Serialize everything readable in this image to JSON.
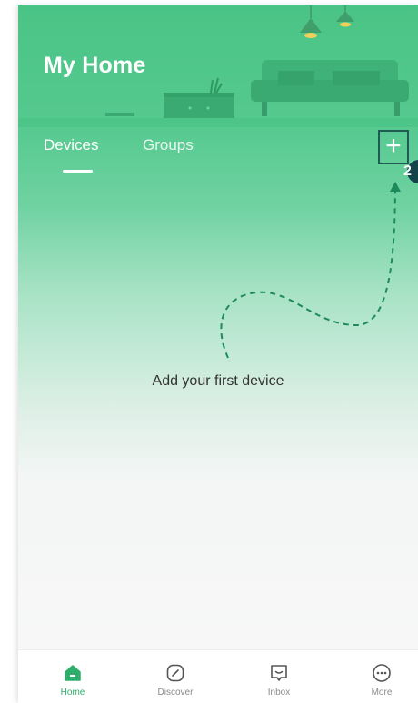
{
  "header": {
    "title": "My Home"
  },
  "tabs": [
    {
      "label": "Devices",
      "active": true
    },
    {
      "label": "Groups",
      "active": false
    }
  ],
  "add_button": {
    "label": "+",
    "callout": "2"
  },
  "empty_state": {
    "message": "Add your first device"
  },
  "bottom_nav": [
    {
      "label": "Home",
      "icon": "home-icon",
      "active": true
    },
    {
      "label": "Discover",
      "icon": "compass-icon",
      "active": false
    },
    {
      "label": "Inbox",
      "icon": "inbox-icon",
      "active": false
    },
    {
      "label": "More",
      "icon": "more-icon",
      "active": false
    }
  ],
  "colors": {
    "accent": "#2fae6b",
    "header": "#4ac485",
    "callout": "#14434a",
    "text": "#333333"
  }
}
